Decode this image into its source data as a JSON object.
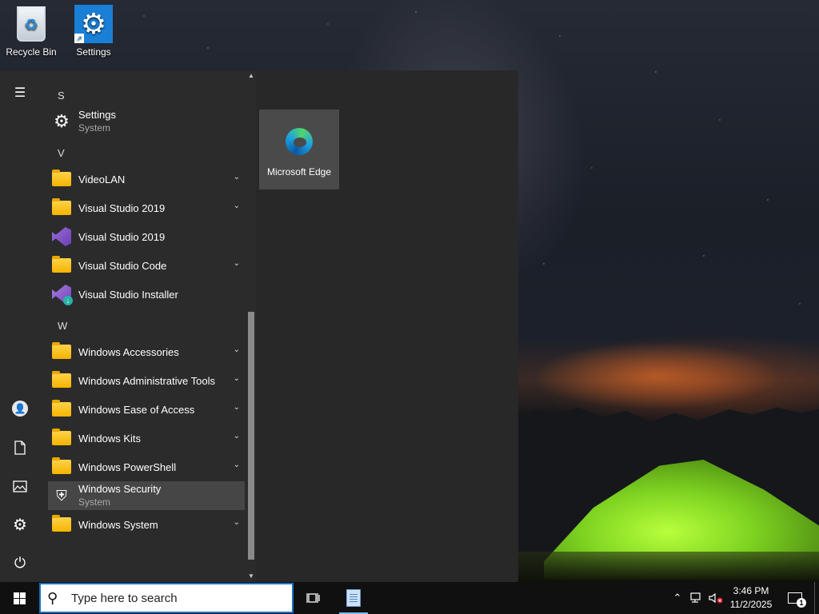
{
  "desktop": {
    "icons": [
      {
        "label": "Recycle Bin"
      },
      {
        "label": "Settings"
      }
    ]
  },
  "start_menu": {
    "rail": {
      "menu_icon": "hamburger-icon",
      "items": [
        "user-icon",
        "documents-icon",
        "pictures-icon",
        "settings-icon",
        "power-icon"
      ]
    },
    "apps": [
      {
        "type": "letter",
        "text": "S"
      },
      {
        "type": "app",
        "label": "Settings",
        "sub": "System",
        "icon": "gear-icon"
      },
      {
        "type": "letter",
        "text": "V"
      },
      {
        "type": "folder",
        "label": "VideoLAN"
      },
      {
        "type": "folder",
        "label": "Visual Studio 2019"
      },
      {
        "type": "app",
        "label": "Visual Studio 2019",
        "icon": "visual-studio-icon"
      },
      {
        "type": "folder",
        "label": "Visual Studio Code"
      },
      {
        "type": "app",
        "label": "Visual Studio Installer",
        "icon": "visual-studio-installer-icon"
      },
      {
        "type": "letter",
        "text": "W"
      },
      {
        "type": "folder",
        "label": "Windows Accessories"
      },
      {
        "type": "folder",
        "label": "Windows Administrative Tools"
      },
      {
        "type": "folder",
        "label": "Windows Ease of Access"
      },
      {
        "type": "folder",
        "label": "Windows Kits"
      },
      {
        "type": "folder",
        "label": "Windows PowerShell"
      },
      {
        "type": "app",
        "label": "Windows Security",
        "sub": "System",
        "icon": "shield-icon",
        "selected": true
      },
      {
        "type": "folder",
        "label": "Windows System"
      }
    ],
    "tiles": [
      {
        "label": "Microsoft Edge",
        "icon": "edge-icon"
      }
    ]
  },
  "taskbar": {
    "search_placeholder": "Type here to search",
    "clock_time": "3:46 PM",
    "clock_date": "11/2/2025",
    "notification_count": "1"
  }
}
